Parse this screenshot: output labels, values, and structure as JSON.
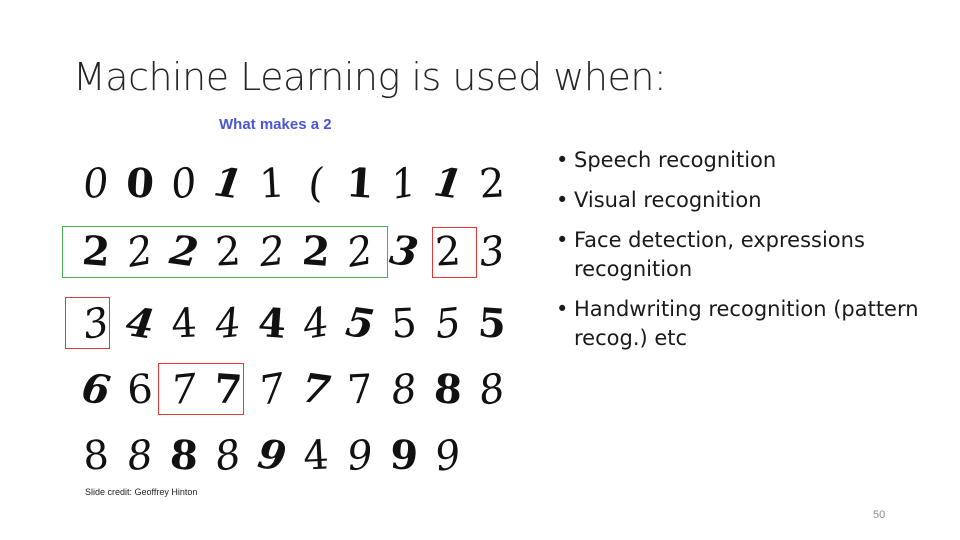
{
  "slide": {
    "title": "Machine Learning is used when:",
    "page_number": "50"
  },
  "figure": {
    "title": "What makes a 2",
    "credit": "Slide credit: Geoffrey Hinton",
    "rows": [
      [
        "0",
        "0",
        "0",
        "1",
        "1",
        "(",
        "1",
        "1",
        "1",
        "2"
      ],
      [
        "2",
        "2",
        "2",
        "2",
        "2",
        "2",
        "2",
        "3",
        "2",
        "3"
      ],
      [
        "3",
        "4",
        "4",
        "4",
        "4",
        "4",
        "5",
        "5",
        "5",
        "5"
      ],
      [
        "6",
        "6",
        "7",
        "7",
        "7",
        "7",
        "7",
        "8",
        "8",
        "8"
      ],
      [
        "8",
        "8",
        "8",
        "8",
        "9",
        "4",
        "9",
        "9",
        "9"
      ]
    ],
    "colors": {
      "green_box": "#4caf50",
      "red_box": "#e53935"
    }
  },
  "bullets": [
    "Speech recognition",
    "Visual recognition",
    "Face detection, expressions recognition",
    "Handwriting recognition (pattern recog.) etc"
  ]
}
